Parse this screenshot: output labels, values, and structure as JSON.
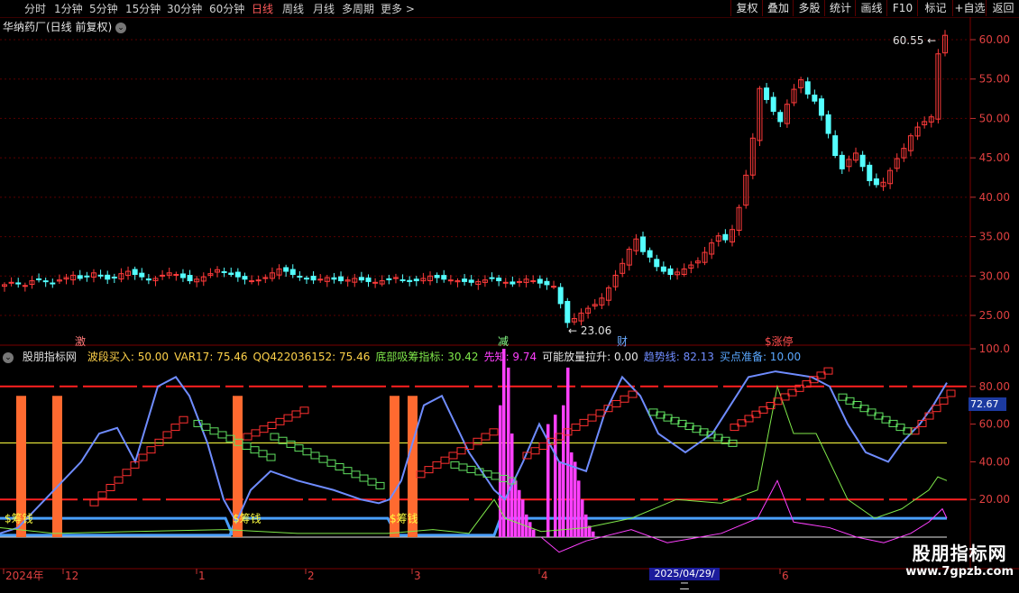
{
  "toolbar": {
    "timeframes": [
      "分时",
      "1分钟",
      "5分钟",
      "15分钟",
      "30分钟",
      "60分钟",
      "日线",
      "周线",
      "月线",
      "多周期",
      "更多 >"
    ],
    "active": "日线",
    "right": [
      "复权",
      "叠加",
      "多股",
      "统计",
      "画线",
      "F10",
      "标记",
      "+自选",
      "返回"
    ]
  },
  "header": {
    "title": "华纳药厂(日线 前复权)"
  },
  "price_axis": [
    "60.00",
    "55.00",
    "50.00",
    "45.00",
    "40.00",
    "35.00",
    "30.00",
    "25.00"
  ],
  "markers": {
    "max": "60.55",
    "min": "23.06",
    "ji": "激",
    "jian": "减",
    "cai": "财",
    "zt": "涨停"
  },
  "indicator": {
    "name": "股朋指标网",
    "items": [
      {
        "label": "波段买入: 50.00",
        "color": "#ffd24a"
      },
      {
        "label": "VAR17: 75.46",
        "color": "#ffd24a"
      },
      {
        "label": "QQ422036152: 75.46",
        "color": "#ffd24a"
      },
      {
        "label": "底部吸筹指标: 30.42",
        "color": "#7fe84a"
      },
      {
        "label": "先知: 9.74",
        "color": "#ff40ff"
      },
      {
        "label": "可能放量拉升: 0.00",
        "color": "#e8e8e8"
      },
      {
        "label": "趋势线: 82.13",
        "color": "#6f8cff"
      },
      {
        "label": "买点准备: 10.00",
        "color": "#5aa8ff"
      }
    ],
    "axis": [
      "100.0",
      "80.00",
      "60.00",
      "40.00",
      "20.00"
    ],
    "current": "72.67",
    "labels": [
      "$筹钱",
      "$筹钱",
      "$筹钱"
    ]
  },
  "date_axis": [
    "2024年",
    "12",
    "1",
    "2",
    "3",
    "4",
    "5",
    "6"
  ],
  "cursor_date": "2025/04/29/二",
  "watermark": {
    "line1": "股朋指标网",
    "line2": "www.7gpzb.com"
  },
  "colors": {
    "up": "#ff3b3b",
    "down": "#54ffff",
    "trend": "#6f8cff",
    "magenta": "#ff40ff",
    "orange": "#ff6a30",
    "green": "#7fe84a",
    "yellow": "#ffff40",
    "blue": "#4aa0ff"
  }
}
